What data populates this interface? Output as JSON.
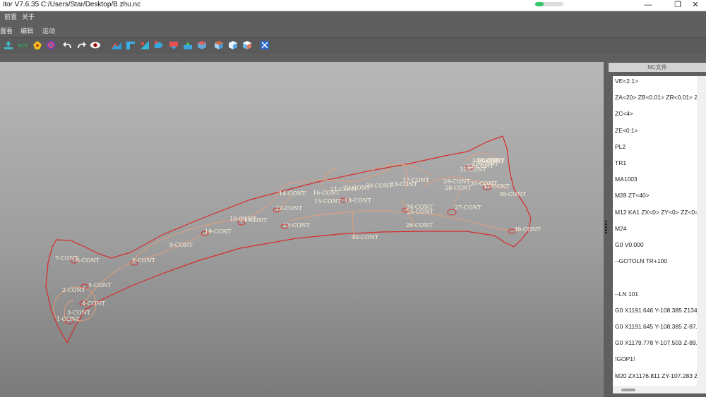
{
  "window": {
    "title": "itor V7.6.35  C:/Users/Star/Desktop/B zhu.nc",
    "progress_fraction": 0.3,
    "minimize_label": "—",
    "maximize_label": "❐",
    "close_label": "✕"
  },
  "menu": {
    "items": [
      "前置",
      "关于"
    ],
    "items2": [
      "置看",
      "编辑",
      "运动"
    ]
  },
  "toolbar": {
    "icons": [
      "import-icon",
      "ncs-icon",
      "shape-icon",
      "target-icon",
      "undo-icon",
      "redo-icon",
      "eye-icon",
      "view-1-icon",
      "view-2-icon",
      "view-3-icon",
      "view-4-icon",
      "view-5-icon",
      "view-6-icon",
      "view-7-icon",
      "cube-1-icon",
      "cube-2-icon",
      "cube-3-icon",
      "fit-icon"
    ],
    "ncs_label": "NCS"
  },
  "viewport": {
    "labels": [
      "1-CONT",
      "2-CONT",
      "3-CONT",
      "4-CONT",
      "5-CONT",
      "6-CONT",
      "7-CONT",
      "8-CONT",
      "9-CONT",
      "10-CONT",
      "11-CONT",
      "12-CONT",
      "13-CONT",
      "14-CONT",
      "15-CONT",
      "16-CONT",
      "17-CONT",
      "18-CONT",
      "19-CONT",
      "20-CONT",
      "21-CONT",
      "22-CONT",
      "23-CONT",
      "24-CONT",
      "25-CONT",
      "26-CONT",
      "27-CONT",
      "28-CONT",
      "29-CONT",
      "30-CONT",
      "31-CONT",
      "32-CONT",
      "33-CONT",
      "34-CONT",
      "35-CONT",
      "36-CONT",
      "37-CONT",
      "38-CONT",
      "39-CONT",
      "40-CONT"
    ]
  },
  "nc_panel": {
    "header": "NC文件",
    "lines": [
      "VE<2.1>",
      "ZA<20> ZB<0.01> ZR<0.01> Z",
      "ZC<4>",
      "ZE<0.1>",
      "PL2",
      "TR1",
      "MA1003",
      "M28 ZT<40>",
      "M12 KA1 ZX<0> ZY<0> ZZ<0>",
      "M24",
      "G0 V0.000",
      "--GOTOLN TR+100",
      "",
      "--LN 101",
      "G0 X1191.646 Y-108.385 Z134.4",
      "G0 X1191.645 Y-108.385 Z-87.5",
      "G0 X1179.778 Y-107.503 Z-89.0",
      "!GOP1!",
      "M20 ZX1176.811 ZY-107.283 Z"
    ]
  },
  "colors": {
    "outline": "#d82a2a",
    "path": "#e8a07a",
    "label": "#fff4de"
  }
}
